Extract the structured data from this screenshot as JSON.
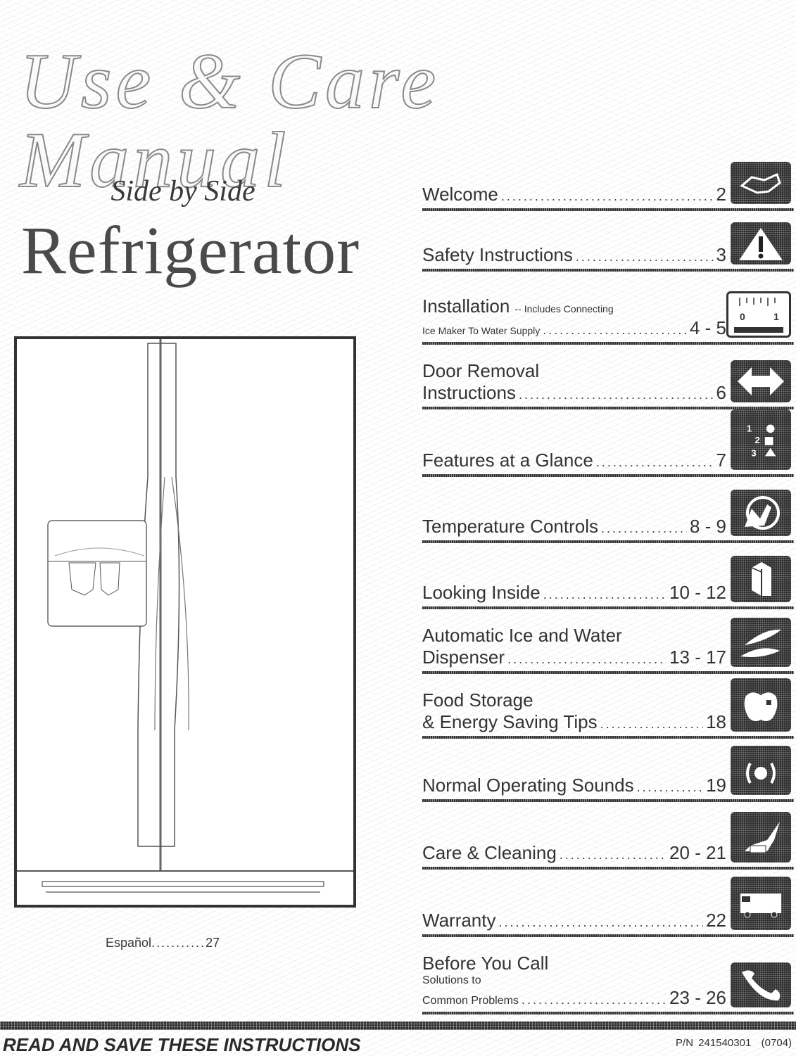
{
  "document": {
    "title": "Use & Care Manual",
    "subtitle": "Side by Side",
    "product": "Refrigerator",
    "espanol": {
      "label": "Español",
      "leader": "...........",
      "page": "27"
    }
  },
  "toc": [
    {
      "title": "Welcome",
      "pages": "2",
      "icon": "handshake-icon"
    },
    {
      "title": "Safety Instructions",
      "pages": "3",
      "icon": "warning-icon"
    },
    {
      "title": "Installation",
      "title_suffix": "-- Includes Connecting",
      "subline": "Ice Maker To Water Supply",
      "pages": "4 - 5",
      "icon": "ruler-icon",
      "icon_labels": [
        "0",
        "1"
      ]
    },
    {
      "title": "Door Removal",
      "title_line2": "Instructions",
      "pages": "6",
      "icon": "double-arrow-icon"
    },
    {
      "title": "Features at a Glance",
      "pages": "7",
      "icon": "numbered-shapes-icon"
    },
    {
      "title": "Temperature Controls",
      "pages": "8 - 9",
      "icon": "hand-dial-icon"
    },
    {
      "title": "Looking Inside",
      "pages": "10 - 12",
      "icon": "refrigerator-box-icon"
    },
    {
      "title": "Automatic Ice and Water",
      "title_line2": "Dispenser",
      "pages": "13 - 17",
      "icon": "leaves-icon"
    },
    {
      "title": "Food Storage",
      "title_line2": "& Energy Saving Tips",
      "pages": "18",
      "icon": "apple-icon"
    },
    {
      "title": "Normal Operating Sounds",
      "pages": "19",
      "icon": "sound-waves-icon"
    },
    {
      "title": "Care & Cleaning",
      "pages": "20 - 21",
      "icon": "cleaning-hand-icon"
    },
    {
      "title": "Warranty",
      "pages": "22",
      "icon": "service-truck-icon"
    },
    {
      "title": "Before You Call",
      "subline1": "Solutions to",
      "subline2": "Common Problems",
      "pages": "23 - 26",
      "icon": "telephone-icon"
    }
  ],
  "footer": {
    "instruction": "READ AND SAVE THESE INSTRUCTIONS",
    "part_number": "P/N 241540301",
    "date_code": "(0704)"
  }
}
